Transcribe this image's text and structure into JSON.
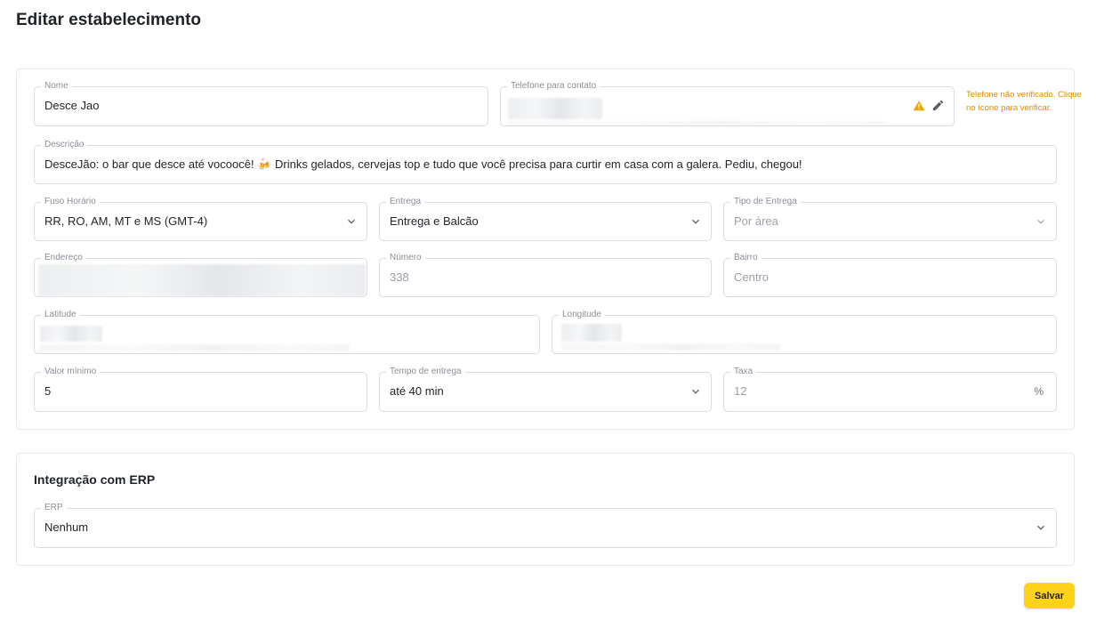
{
  "page": {
    "title": "Editar estabelecimento"
  },
  "form": {
    "nome": {
      "label": "Nome",
      "value": "Desce Jao"
    },
    "telefone": {
      "label": "Telefone para contato",
      "warning": "Telefone não verificado. Clique no ícone para verificar.",
      "icons": [
        "warning-icon",
        "edit-icon"
      ],
      "warning_color": "#e08a00"
    },
    "descricao": {
      "label": "Descrição",
      "value": "DesceJão: o bar que desce até vocoocê! 🍻 Drinks gelados, cervejas top e tudo que você precisa para curtir em casa com a galera. Pediu, chegou!"
    },
    "fuso": {
      "label": "Fuso Horário",
      "value": "RR, RO, AM, MT e MS (GMT-4)"
    },
    "entrega": {
      "label": "Entrega",
      "value": "Entrega e Balcão"
    },
    "tipo_entrega": {
      "label": "Tipo de Entrega",
      "value": "Por área"
    },
    "endereco": {
      "label": "Endereço"
    },
    "numero": {
      "label": "Número",
      "value": "338"
    },
    "bairro": {
      "label": "Bairro",
      "value": "Centro"
    },
    "latitude": {
      "label": "Latitude"
    },
    "longitude": {
      "label": "Longitude"
    },
    "valor_minimo": {
      "label": "Valor mínimo",
      "value": "5"
    },
    "tempo_entrega": {
      "label": "Tempo de entrega",
      "value": "até 40 min"
    },
    "taxa": {
      "label": "Taxa",
      "value": "12",
      "suffix": "%"
    }
  },
  "erp": {
    "title": "Integração com ERP",
    "field": {
      "label": "ERP",
      "value": "Nenhum"
    }
  },
  "actions": {
    "save_label": "Salvar"
  },
  "colors": {
    "accent": "#ffd21a",
    "warning": "#e08a00",
    "border": "#d8dbe0"
  }
}
